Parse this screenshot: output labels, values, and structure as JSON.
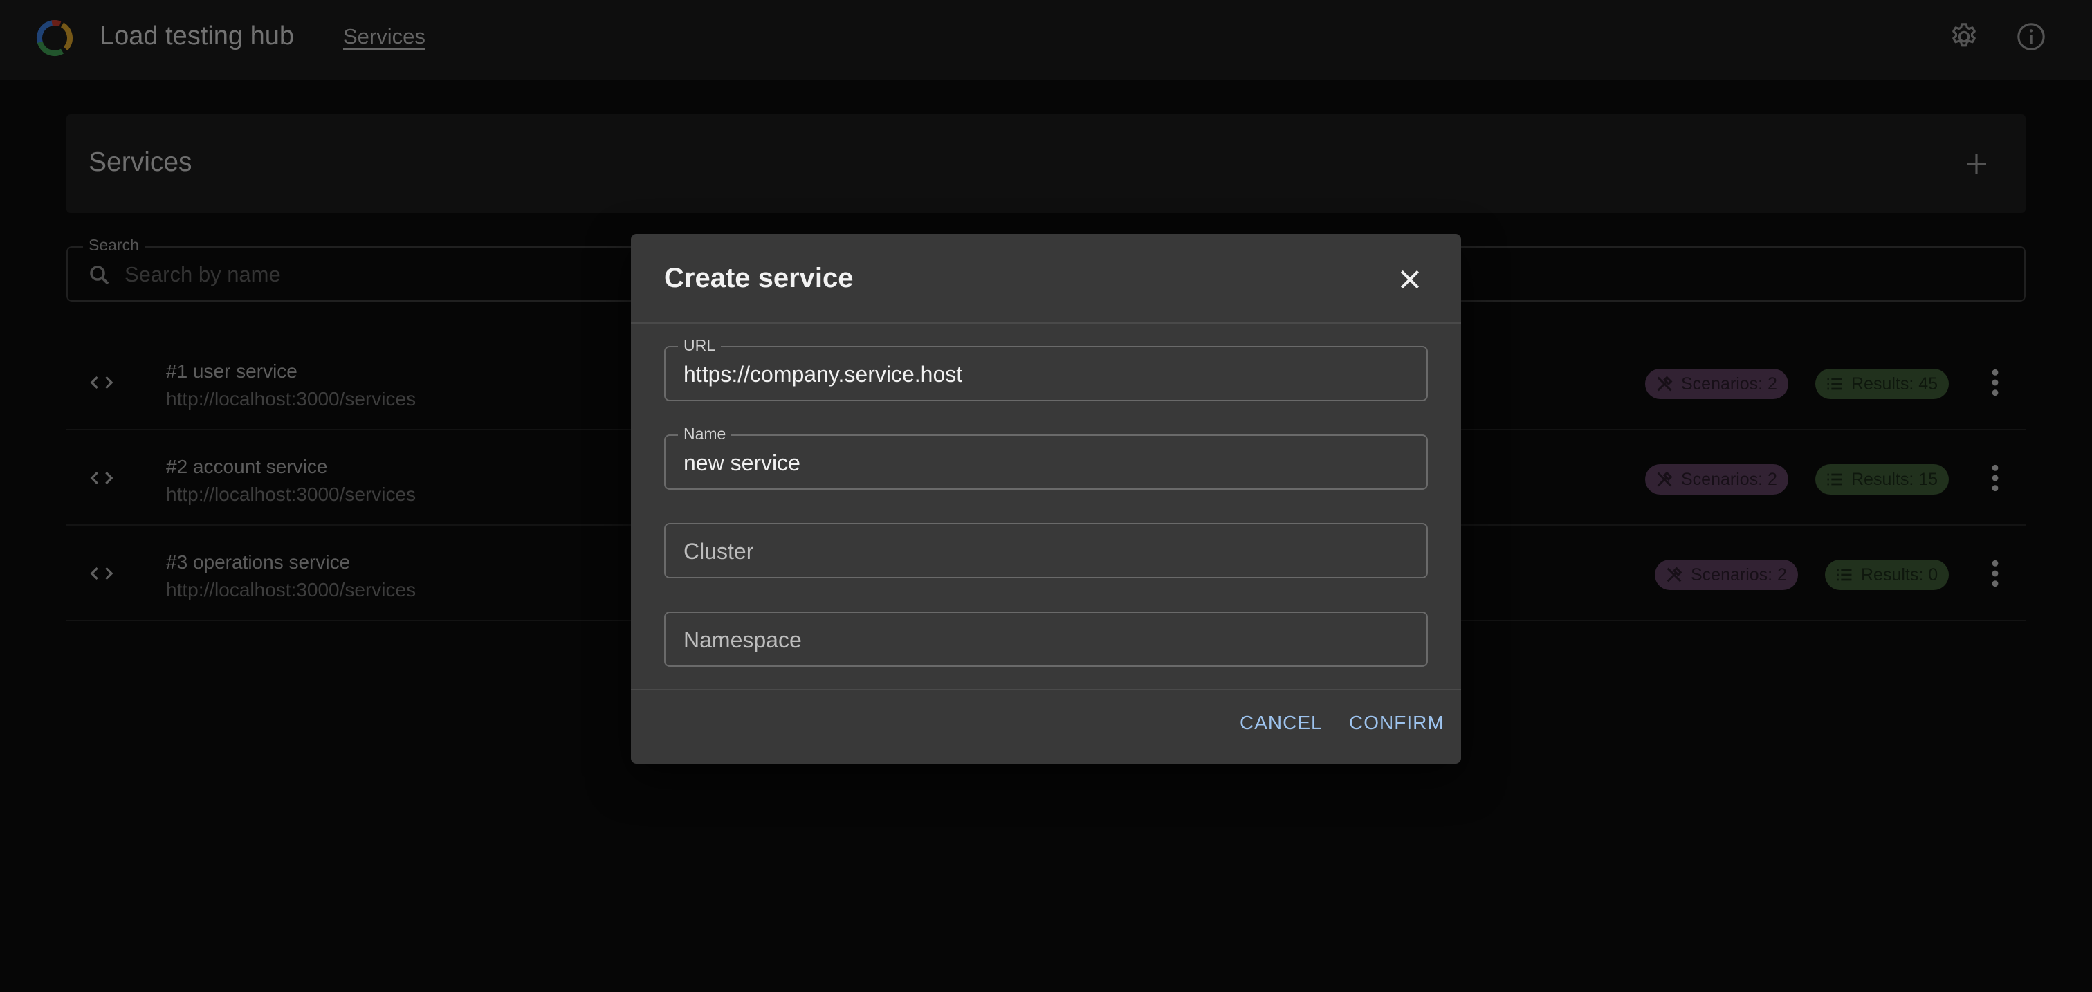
{
  "appbar": {
    "title": "Load testing hub",
    "nav_link": "Services"
  },
  "panel": {
    "title": "Services"
  },
  "search": {
    "label": "Search",
    "placeholder": "Search by name"
  },
  "services": [
    {
      "title": "#1 user service",
      "url": "http://localhost:3000/services",
      "scenarios": "Scenarios: 2",
      "results": "Results: 45"
    },
    {
      "title": "#2 account service",
      "url": "http://localhost:3000/services",
      "scenarios": "Scenarios: 2",
      "results": "Results: 15"
    },
    {
      "title": "#3 operations service",
      "url": "http://localhost:3000/services",
      "scenarios": "Scenarios: 2",
      "results": "Results: 0"
    }
  ],
  "dialog": {
    "title": "Create service",
    "url_label": "URL",
    "url_value": "https://company.service.host",
    "name_label": "Name",
    "name_value": "new service",
    "cluster_placeholder": "Cluster",
    "namespace_placeholder": "Namespace",
    "cancel_label": "CANCEL",
    "confirm_label": "CONFIRM"
  },
  "colors": {
    "accent": "#9dc3ee",
    "scenarios_chip": "#5b3f5e",
    "results_chip": "#3d5a36"
  }
}
